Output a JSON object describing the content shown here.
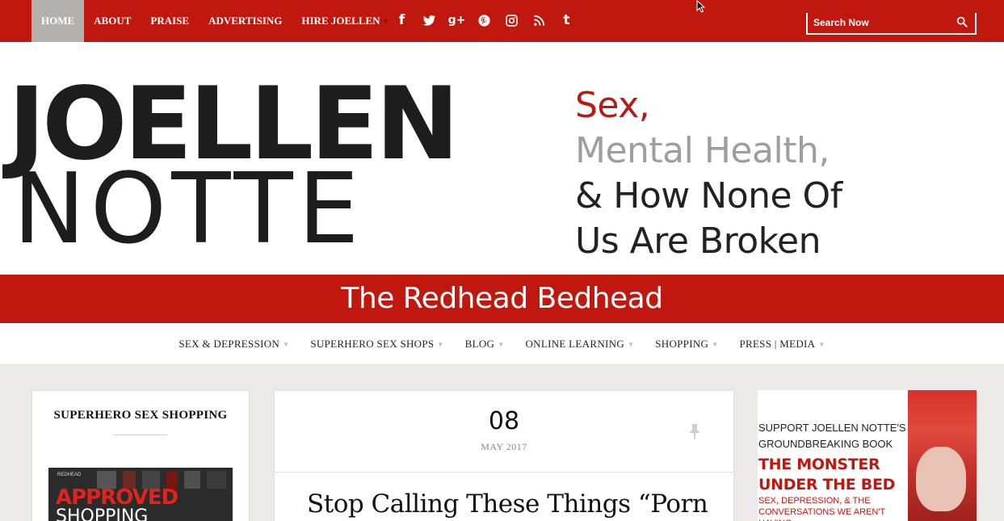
{
  "topbar": {
    "nav": [
      {
        "label": "HOME",
        "active": true
      },
      {
        "label": "ABOUT"
      },
      {
        "label": "PRAISE"
      },
      {
        "label": "ADVERTISING"
      },
      {
        "label": "HIRE JOELLEN",
        "has_dropdown": true
      }
    ],
    "social_icons": [
      "facebook-icon",
      "twitter-icon",
      "google-plus-icon",
      "pinterest-icon",
      "instagram-icon",
      "rss-icon",
      "tumblr-icon"
    ],
    "social_glyphs": {
      "facebook": "f",
      "google_plus": "g+",
      "tumblr": "t"
    },
    "search": {
      "placeholder": "Search Now"
    },
    "accent_color": "#c0170e"
  },
  "header": {
    "logo_line1": "JOELLEN",
    "logo_line2": "NOTTE",
    "tagline_1": "Sex,",
    "tagline_2": "Mental Health,",
    "tagline_3": "& How None Of",
    "tagline_4": "Us Are Broken",
    "subtitle": "The Redhead Bedhead"
  },
  "main_nav": [
    {
      "label": "SEX & DEPRESSION"
    },
    {
      "label": "SUPERHERO SEX SHOPS"
    },
    {
      "label": "BLOG"
    },
    {
      "label": "ONLINE LEARNING"
    },
    {
      "label": "SHOPPING"
    },
    {
      "label": "PRESS | MEDIA"
    }
  ],
  "sidebar_left": {
    "widget_title": "SUPERHERO SEX SHOPPING",
    "promo_small": "REDHEAD",
    "promo_big": "APPROVED",
    "promo_big2": "SHOPPING"
  },
  "post": {
    "day": "08",
    "month_year": "MAY 2017",
    "title": "Stop Calling These Things “Porn"
  },
  "sidebar_right": {
    "ad_line1": "SUPPORT JOELLEN NOTTE'S",
    "ad_line2": "GROUNDBREAKING BOOK",
    "ad_big1": "THE MONSTER",
    "ad_big2": "UNDER THE BED",
    "ad_small1": "SEX, DEPRESSION, & THE",
    "ad_small2": "CONVERSATIONS WE AREN'T HAVING"
  }
}
